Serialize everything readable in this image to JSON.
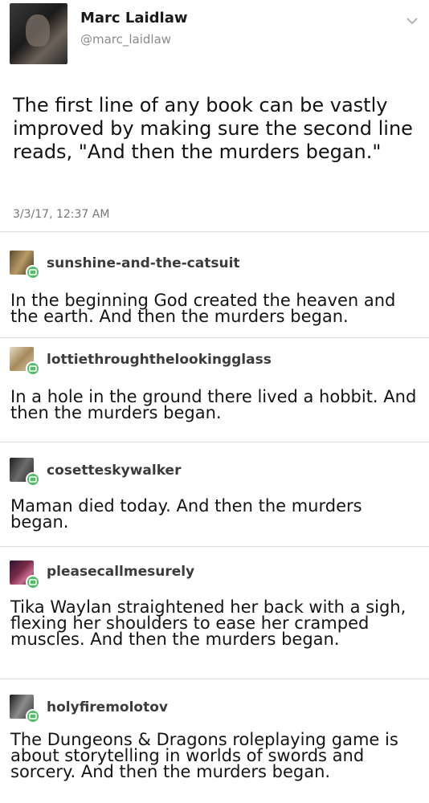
{
  "tweet": {
    "name": "Marc Laidlaw",
    "handle": "@marc_laidlaw",
    "text": "The first line of any book can be vastly improved by making sure the second line reads, \"And then the murders began.\"",
    "date": "3/3/17, 12:37 AM"
  },
  "reblogs": [
    {
      "username": "sunshine-and-the-catsuit",
      "text": "In the beginning God created the heaven and the earth. And then the murders began."
    },
    {
      "username": "lottiethroughthelookingglass",
      "text": "In a hole in the ground there lived a hobbit. And then the murders began."
    },
    {
      "username": "cosetteskywalker",
      "text": "Maman died today. And then the murders began."
    },
    {
      "username": "pleasecallmesurely",
      "text": "Tika Waylan straightened her back with a sigh, flexing her shoulders to ease her cramped muscles. And then the murders began."
    },
    {
      "username": "holyfiremolotov",
      "text": "The Dungeons & Dragons roleplaying game is about storytelling in worlds of swords and sorcery. And then the murders began."
    }
  ],
  "colors": {
    "badge": "#56b96b",
    "divider": "#dcdcdc"
  }
}
